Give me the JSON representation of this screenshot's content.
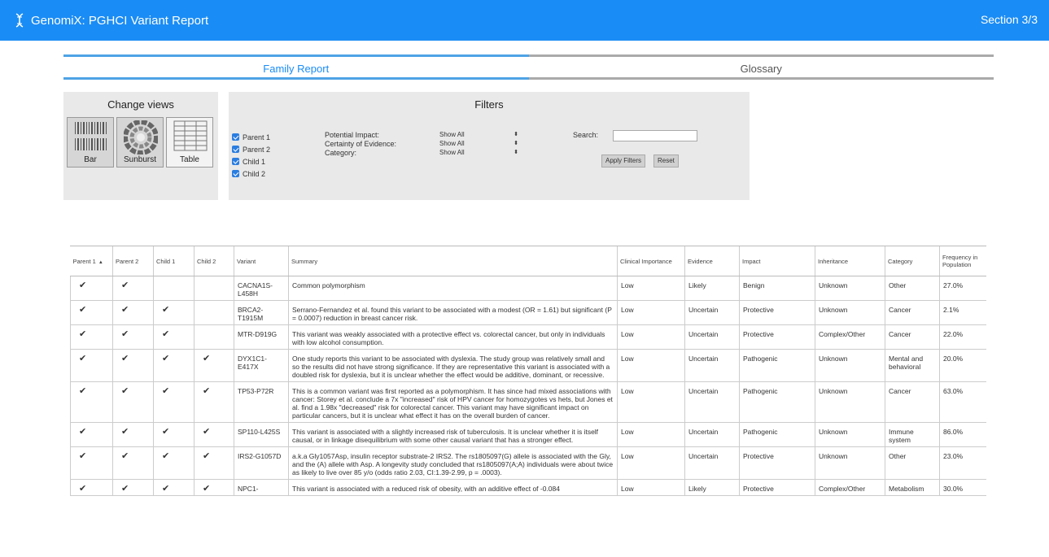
{
  "app": {
    "title": "GenomiX: PGHCI Variant Report",
    "section": "Section 3/3"
  },
  "tabs": [
    {
      "label": "Family Report"
    },
    {
      "label": "Glossary"
    }
  ],
  "views": {
    "title": "Change views",
    "buttons": [
      {
        "label": "Bar"
      },
      {
        "label": "Sunburst"
      },
      {
        "label": "Table"
      }
    ]
  },
  "filters": {
    "title": "Filters",
    "members": [
      {
        "label": "Parent 1"
      },
      {
        "label": "Parent 2"
      },
      {
        "label": "Child 1"
      },
      {
        "label": "Child 2"
      }
    ],
    "fields": [
      {
        "label": "Potential Impact:",
        "value": "Show All"
      },
      {
        "label": "Certainty of Evidence:",
        "value": "Show All"
      },
      {
        "label": "Category:",
        "value": "Show All"
      }
    ],
    "search_label": "Search:",
    "search_value": "",
    "apply_label": "Apply Filters",
    "reset_label": "Reset"
  },
  "table": {
    "check_glyph": "✔",
    "sort_glyph": "▲",
    "columns": [
      "Parent 1",
      "Parent 2",
      "Child 1",
      "Child 2",
      "Variant",
      "Summary",
      "Clinical Importance",
      "Evidence",
      "Impact",
      "Inheritance",
      "Category",
      "Frequency in Population"
    ],
    "rows": [
      {
        "p1": "✔",
        "p2": "✔",
        "c1": "",
        "c2": "",
        "variant": "CACNA1S-L458H",
        "summary": "Common polymorphism",
        "clinical": "Low",
        "evidence": "Likely",
        "impact": "Benign",
        "inheritance": "Unknown",
        "category": "Other",
        "frequency": "27.0%"
      },
      {
        "p1": "✔",
        "p2": "✔",
        "c1": "✔",
        "c2": "",
        "variant": "BRCA2-T1915M",
        "summary": "Serrano-Fernandez et al. found this variant to be associated with a modest (OR = 1.61) but significant (P = 0.0007) reduction in breast cancer risk.",
        "clinical": "Low",
        "evidence": "Uncertain",
        "impact": "Protective",
        "inheritance": "Unknown",
        "category": "Cancer",
        "frequency": "2.1%"
      },
      {
        "p1": "✔",
        "p2": "✔",
        "c1": "✔",
        "c2": "",
        "variant": "MTR-D919G",
        "summary": "This variant was weakly associated with a protective effect vs. colorectal cancer, but only in individuals with low alcohol consumption.",
        "clinical": "Low",
        "evidence": "Uncertain",
        "impact": "Protective",
        "inheritance": "Complex/Other",
        "category": "Cancer",
        "frequency": "22.0%"
      },
      {
        "p1": "✔",
        "p2": "✔",
        "c1": "✔",
        "c2": "✔",
        "variant": "DYX1C1-E417X",
        "summary": "One study reports this variant to be associated with dyslexia. The study group was relatively small and so the results did not have strong significance. If they are representative this variant is associated with a doubled risk for dyslexia, but it is unclear whether the effect would be additive, dominant, or recessive.",
        "clinical": "Low",
        "evidence": "Uncertain",
        "impact": "Pathogenic",
        "inheritance": "Unknown",
        "category": "Mental and behavioral",
        "frequency": "20.0%"
      },
      {
        "p1": "✔",
        "p2": "✔",
        "c1": "✔",
        "c2": "✔",
        "variant": "TP53-P72R",
        "summary": "This is a common variant was first reported as a polymorphism. It has since had mixed associations with cancer: Storey et al. conclude a 7x \"increased\" risk of HPV cancer for homozygotes vs hets, but Jones et al. find a 1.98x \"decreased\" risk for colorectal cancer. This variant may have significant impact on particular cancers, but it is unclear what effect it has on the overall burden of cancer.",
        "clinical": "Low",
        "evidence": "Uncertain",
        "impact": "Pathogenic",
        "inheritance": "Unknown",
        "category": "Cancer",
        "frequency": "63.0%"
      },
      {
        "p1": "✔",
        "p2": "✔",
        "c1": "✔",
        "c2": "✔",
        "variant": "SP110-L425S",
        "summary": "This variant is associated with a slightly increased risk of tuberculosis. It is unclear whether it is itself causal, or in linkage disequilibrium with some other causal variant that has a stronger effect.",
        "clinical": "Low",
        "evidence": "Uncertain",
        "impact": "Pathogenic",
        "inheritance": "Unknown",
        "category": "Immune system",
        "frequency": "86.0%"
      },
      {
        "p1": "✔",
        "p2": "✔",
        "c1": "✔",
        "c2": "✔",
        "variant": "IRS2-G1057D",
        "summary": "a.k.a Gly1057Asp, insulin receptor substrate-2 IRS2. The rs1805097(G) allele is associated with the Gly, and the (A) allele with Asp. A longevity study concluded that rs1805097(A;A) individuals were about twice as likely to live over 85 y/o (odds ratio 2.03, CI:1.39-2.99, p = .0003).",
        "clinical": "Low",
        "evidence": "Uncertain",
        "impact": "Protective",
        "inheritance": "Unknown",
        "category": "Other",
        "frequency": "23.0%"
      },
      {
        "p1": "✔",
        "p2": "✔",
        "c1": "✔",
        "c2": "✔",
        "variant": "NPC1-",
        "summary": "This variant is associated with a reduced risk of obesity, with an additive effect of -0.084",
        "clinical": "Low",
        "evidence": "Likely",
        "impact": "Protective",
        "inheritance": "Complex/Other",
        "category": "Metabolism",
        "frequency": "30.0%"
      }
    ]
  }
}
